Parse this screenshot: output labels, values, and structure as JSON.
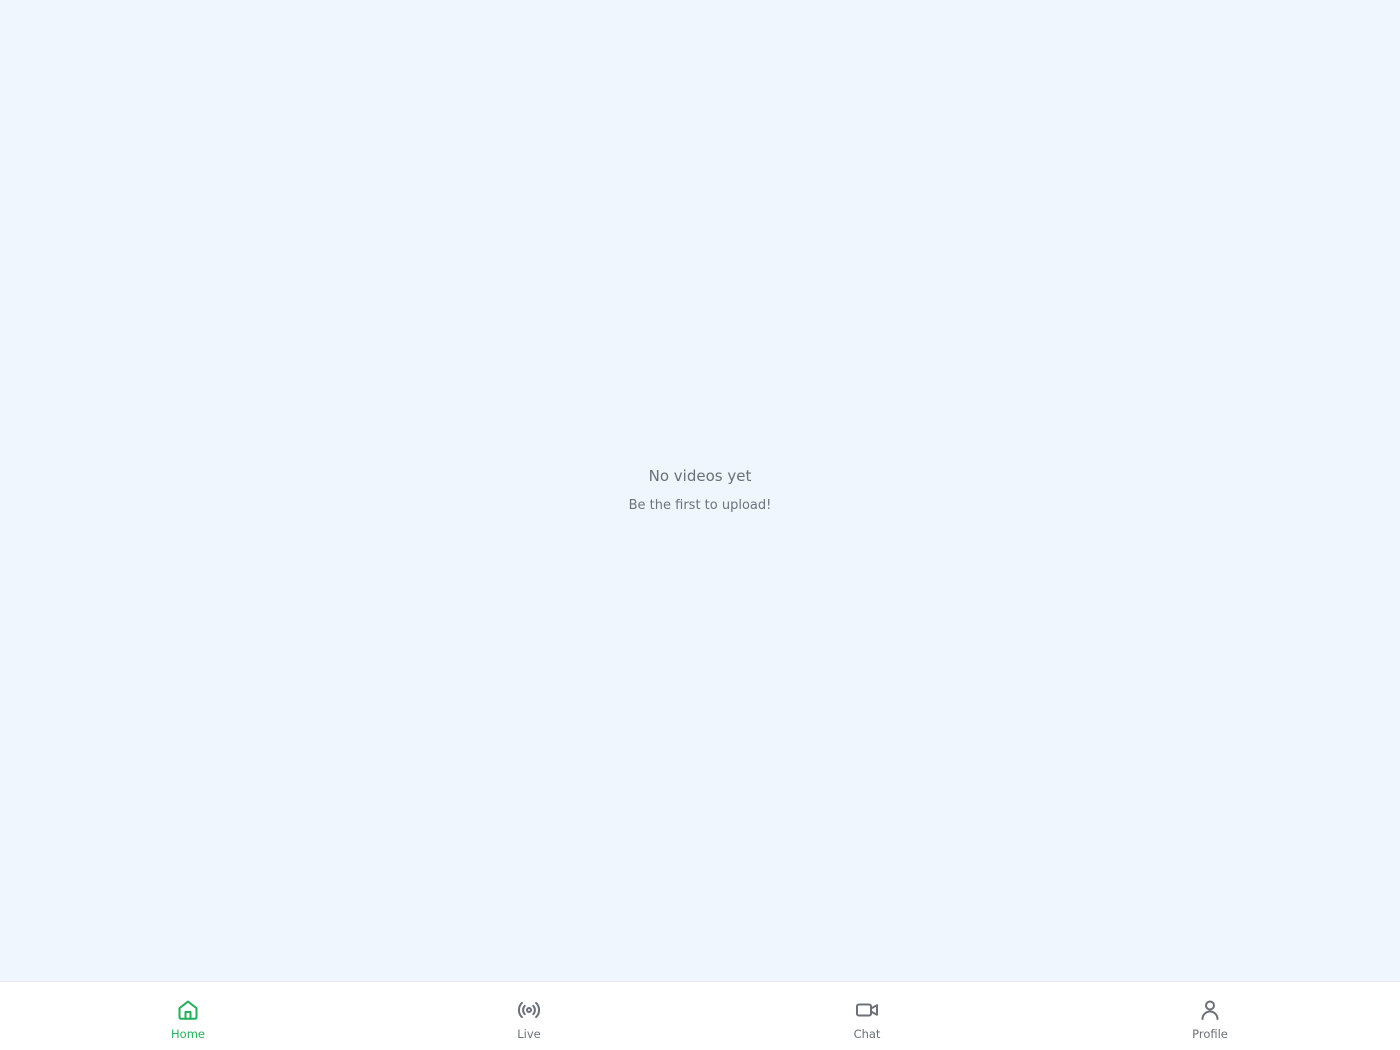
{
  "empty_state": {
    "title": "No videos yet",
    "subtitle": "Be the first to upload!"
  },
  "nav": {
    "active": "home",
    "active_color": "#22b05a",
    "inactive_color": "#6b7079",
    "items": [
      {
        "id": "home",
        "label": "Home",
        "icon": "home-icon"
      },
      {
        "id": "live",
        "label": "Live",
        "icon": "broadcast-icon"
      },
      {
        "id": "chat",
        "label": "Chat",
        "icon": "video-camera-icon"
      },
      {
        "id": "profile",
        "label": "Profile",
        "icon": "user-icon"
      }
    ]
  }
}
